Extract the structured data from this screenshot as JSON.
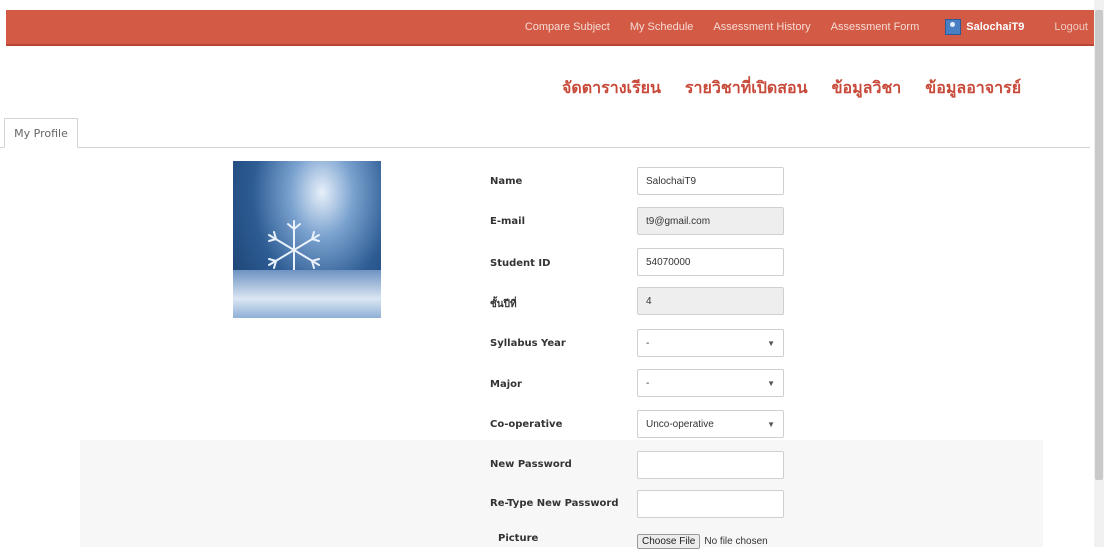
{
  "topnav": {
    "links": [
      "Compare Subject",
      "My Schedule",
      "Assessment History",
      "Assessment Form"
    ],
    "user": "SalochaiT9",
    "logout": "Logout"
  },
  "thai_menu": [
    "จัดตารางเรียน",
    "รายวิชาที่เปิดสอน",
    "ข้อมูลวิชา",
    "ข้อมูลอาจารย์"
  ],
  "tab": {
    "label": "My Profile"
  },
  "form": {
    "name": {
      "label": "Name",
      "value": "SalochaiT9"
    },
    "email": {
      "label": "E-mail",
      "value": "t9@gmail.com"
    },
    "student_id": {
      "label": "Student ID",
      "value": "54070000"
    },
    "year": {
      "label": "ชั้นปีที่",
      "value": "4"
    },
    "syllabus_year": {
      "label": "Syllabus Year",
      "value": "-"
    },
    "major": {
      "label": "Major",
      "value": "-"
    },
    "cooperative": {
      "label": "Co-operative",
      "value": "Unco-operative"
    },
    "new_password": {
      "label": "New Password",
      "value": ""
    },
    "retype_password": {
      "label": "Re-Type New Password",
      "value": ""
    },
    "picture": {
      "label": "Picture",
      "button": "Choose File",
      "status": "No file chosen"
    }
  },
  "colors": {
    "navbar": "#d35a45",
    "thai_menu": "#c84a3a"
  }
}
